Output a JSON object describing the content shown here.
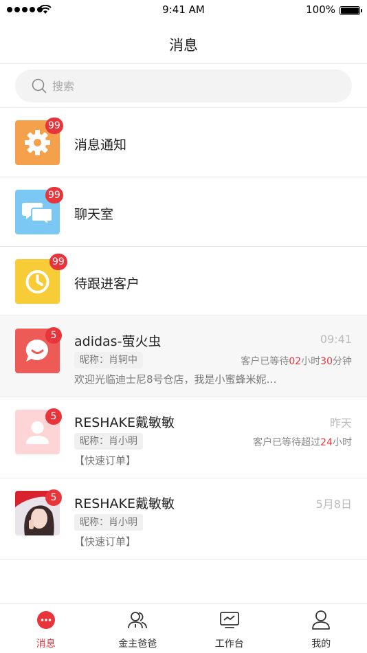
{
  "status_bar": {
    "time": "9:41 AM",
    "battery": "100%"
  },
  "nav": {
    "title": "消息"
  },
  "search": {
    "placeholder": "搜索"
  },
  "system_items": [
    {
      "label": "消息通知",
      "badge": "99",
      "icon": "gear-icon",
      "color": "#F5A04A"
    },
    {
      "label": "聊天室",
      "badge": "99",
      "icon": "chat-bubbles-icon",
      "color": "#7CC8F5"
    },
    {
      "label": "待跟进客户",
      "badge": "99",
      "icon": "clock-icon",
      "color": "#F7CC36"
    }
  ],
  "conversations": [
    {
      "name": "adidas-萤火虫",
      "time": "09:41",
      "nickname": "昵称：肖轲中",
      "wait": {
        "prefix": "客户已等待",
        "n1": "02",
        "u1": "小时",
        "n2": "30",
        "u2": "分钟"
      },
      "preview": "欢迎光临迪士尼8号仓店，我是小蜜蜂米妮…",
      "badge": "5",
      "avatar_color": "#EE5A55"
    },
    {
      "name": "RESHAKE戴敏敏",
      "time": "昨天",
      "nickname": "昵称：肖小明",
      "wait": {
        "prefix": "客户已等待超过",
        "n1": "24",
        "u1": "小时"
      },
      "preview": "【快速订单】",
      "badge": "5",
      "avatar_color": "#FDD5D6"
    },
    {
      "name": "RESHAKE戴敏敏",
      "time": "5月8日",
      "nickname": "昵称：肖小明",
      "preview": "【快速订单】",
      "badge": "5"
    }
  ],
  "tabbar": [
    {
      "label": "消息",
      "icon": "message-dots-icon",
      "active": true
    },
    {
      "label": "金主爸爸",
      "icon": "users-icon"
    },
    {
      "label": "工作台",
      "icon": "monitor-icon"
    },
    {
      "label": "我的",
      "icon": "person-icon"
    }
  ],
  "colors": {
    "accent": "#E8353C"
  }
}
